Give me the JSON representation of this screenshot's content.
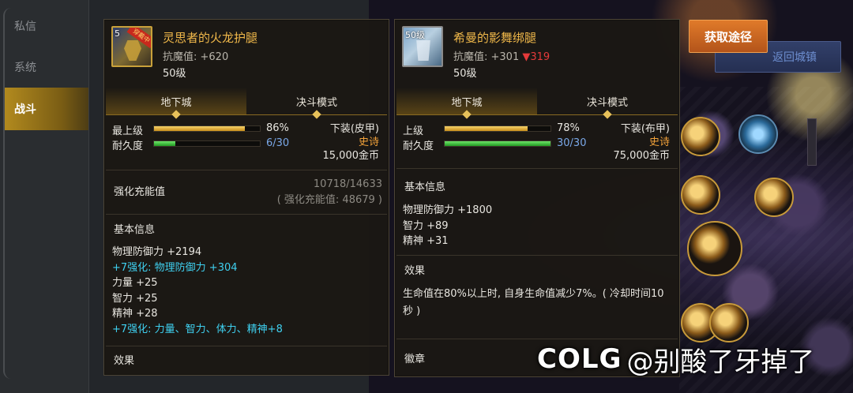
{
  "sidebar": {
    "tabs": [
      {
        "label": "私信",
        "active": false
      },
      {
        "label": "系统",
        "active": false
      },
      {
        "label": "战斗",
        "active": true
      }
    ]
  },
  "item_left": {
    "icon_level_tag": "5",
    "icon_stamp": "穿戴中",
    "name": "灵思者的火龙护腿",
    "stat": "抗魔值: +620",
    "level": "50级",
    "tabs": {
      "active": "地下城",
      "inactive": "决斗模式"
    },
    "bars": [
      {
        "label": "最上级",
        "value": "86%",
        "fill": 0.86,
        "kind": "gold"
      },
      {
        "label": "耐久度",
        "value": "6/30",
        "fill": 0.2,
        "kind": "green"
      }
    ],
    "type": "下装(皮甲)",
    "rarity": "史诗",
    "price": "15,000金币",
    "enhance_title": "强化充能值",
    "enhance_value": "10718/14633",
    "enhance_note": "( 强化充能值: 48679 )",
    "basic_title": "基本信息",
    "basic_lines": [
      {
        "text": "物理防御力 +2194",
        "cyan": false
      },
      {
        "text": "+7强化: 物理防御力 +304",
        "cyan": true
      },
      {
        "text": "力量 +25",
        "cyan": false
      },
      {
        "text": "智力 +25",
        "cyan": false
      },
      {
        "text": "精神 +28",
        "cyan": false
      },
      {
        "text": "+7强化: 力量、智力、体力、精神+8",
        "cyan": true
      }
    ],
    "effect_title": "效果"
  },
  "item_right": {
    "icon_level_tag": "50级",
    "name": "希曼的影舞绑腿",
    "stat_prefix": "抗魔值: +301",
    "stat_drop": "▼319",
    "level": "50级",
    "tabs": {
      "active": "地下城",
      "inactive": "决斗模式"
    },
    "bars": [
      {
        "label": "上级",
        "value": "78%",
        "fill": 0.78,
        "kind": "gold"
      },
      {
        "label": "耐久度",
        "value": "30/30",
        "fill": 1.0,
        "kind": "green"
      }
    ],
    "type": "下装(布甲)",
    "rarity": "史诗",
    "price": "75,000金币",
    "basic_title": "基本信息",
    "basic_lines": [
      {
        "text": "物理防御力 +1800",
        "cyan": false
      },
      {
        "text": "智力 +89",
        "cyan": false
      },
      {
        "text": "精神 +31",
        "cyan": false
      }
    ],
    "effect_title": "效果",
    "effect_desc": "生命值在80%以上时, 自身生命值减少7%。( 冷却时间10秒 )",
    "badge_title": "徽章"
  },
  "buttons": {
    "acquire": "获取途径",
    "return_town": "返回城镇"
  },
  "watermark": {
    "logo": "COLG",
    "user": "@别酸了牙掉了"
  },
  "colors": {
    "item_name": "#f0b84a",
    "epic": "#f2a23a",
    "cyan": "#3fd0f0",
    "drop_red": "#e43a3a",
    "acquire_button": "#d06a22"
  }
}
